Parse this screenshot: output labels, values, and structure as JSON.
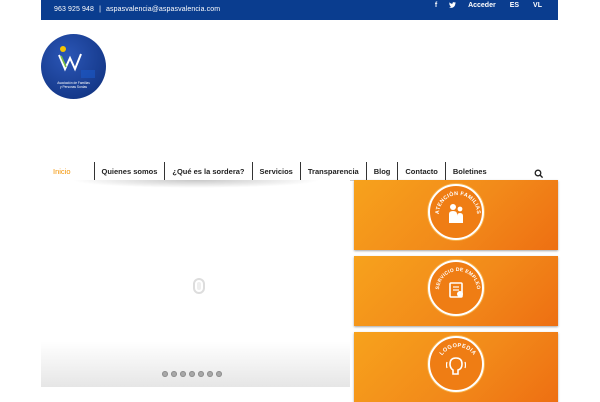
{
  "topbar": {
    "phone": "963 925 948",
    "separator": "|",
    "email": "aspasvalencia@aspasvalencia.com",
    "social": [
      {
        "icon": "facebook-icon",
        "glyph": "f"
      },
      {
        "icon": "twitter-icon",
        "glyph": "🐦"
      }
    ],
    "login_label": "Acceder",
    "languages": [
      "ES",
      "VL"
    ]
  },
  "logo": {
    "name": "ASPAS Valencia",
    "caption_line1": "Asociación de Familias",
    "caption_line2": "y Personas Sordas"
  },
  "nav": {
    "items": [
      {
        "label": "Inicio",
        "active": true
      },
      {
        "label": "Quienes somos",
        "active": false
      },
      {
        "label": "¿Qué es la sordera?",
        "active": false
      },
      {
        "label": "Servicios",
        "active": false
      },
      {
        "label": "Transparencia",
        "active": false
      },
      {
        "label": "Blog",
        "active": false
      },
      {
        "label": "Contacto",
        "active": false
      },
      {
        "label": "Boletines",
        "active": false
      }
    ],
    "search_icon": "search-icon",
    "active_color": "#f39200"
  },
  "slider": {
    "dot_count": 7,
    "loader_icon": "loading-icon"
  },
  "cards": [
    {
      "title": "ATENCIÓN FAMILIAS",
      "icon": "family-icon"
    },
    {
      "title": "SERVICIO DE EMPLEO",
      "icon": "employment-icon"
    },
    {
      "title": "LOGOPEDIA",
      "icon": "speech-therapy-icon"
    }
  ],
  "colors": {
    "topbar": "#0a3d8f",
    "accent": "#f39200",
    "card_orange": "#f28a1a"
  }
}
